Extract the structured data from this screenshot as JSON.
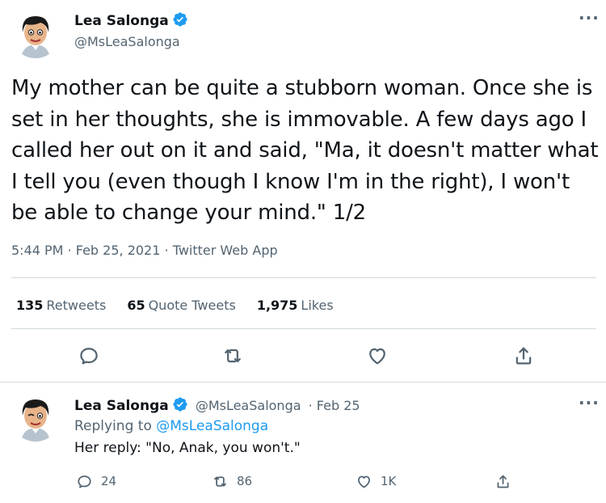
{
  "main_tweet": {
    "author_name": "Lea Salonga",
    "author_handle": "@MsLeaSalonga",
    "text": "My mother can be quite a stubborn woman. Once she is set in her thoughts, she is immovable. A few days ago I called her out on it and said, \"Ma, it doesn't matter what I tell you (even though I know I'm in the right), I won't be able to change your mind.\" 1/2",
    "time": "5:44 PM",
    "date": "Feb 25, 2021",
    "source": "Twitter Web App",
    "sep": "·",
    "retweets_count": "135",
    "retweets_label": "Retweets",
    "quotes_count": "65",
    "quotes_label": "Quote Tweets",
    "likes_count": "1,975",
    "likes_label": "Likes",
    "more": "···"
  },
  "reply_tweet": {
    "author_name": "Lea Salonga",
    "author_handle": "@MsLeaSalonga",
    "date_suffix": "· Feb 25",
    "replying_prefix": "Replying to",
    "replying_handle": "@MsLeaSalonga",
    "text": "Her reply: \"No, Anak, you won't.\"",
    "reply_count": "24",
    "retweet_count": "86",
    "like_count": "1K",
    "more": "···"
  },
  "colors": {
    "text": "#0f1419",
    "secondary": "#536471",
    "accent": "#1d9bf0",
    "divider": "#cfd9de"
  },
  "icons": [
    "verified-badge-icon",
    "more-icon",
    "reply-icon",
    "retweet-icon",
    "like-icon",
    "share-icon"
  ]
}
